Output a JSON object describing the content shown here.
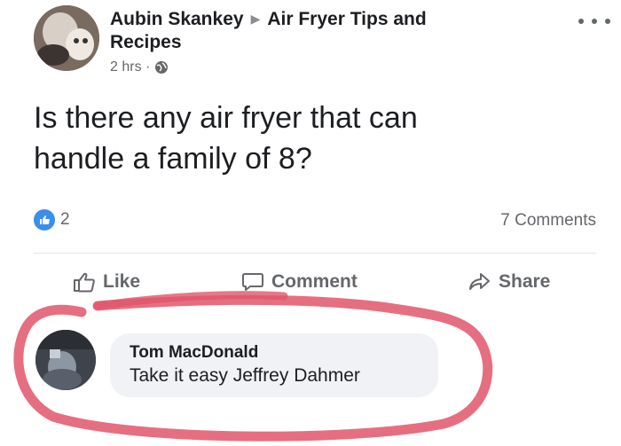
{
  "post": {
    "author": "Aubin Skankey",
    "group": "Air Fryer Tips and",
    "group_cont": "Recipes",
    "time": "2 hrs ·",
    "text_line1": "Is there any air fryer that can",
    "text_line2": "handle a family of 8?",
    "reactions": "2",
    "comments_count": "7 Comments"
  },
  "actions": {
    "like": "Like",
    "comment": "Comment",
    "share": "Share"
  },
  "comment": {
    "author": "Tom MacDonald",
    "text": "Take it easy Jeffrey Dahmer"
  },
  "icons": {
    "globe": "globe-icon",
    "like": "thumbs-up-icon",
    "comment": "speech-bubble-icon",
    "share": "share-arrow-icon",
    "more": "ellipsis-icon"
  },
  "colors": {
    "accent": "#3b8eea",
    "annotation": "#e0566b",
    "muted": "#65676b"
  }
}
